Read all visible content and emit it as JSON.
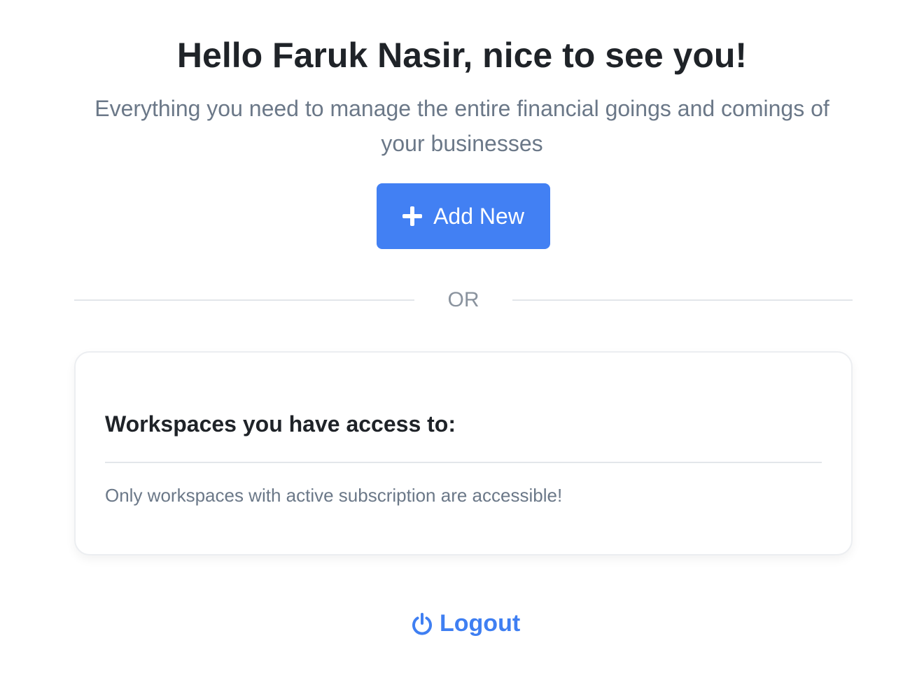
{
  "header": {
    "greeting": "Hello Faruk Nasir, nice to see you!",
    "subtitle": "Everything you need to manage the entire financial goings and comings of your businesses"
  },
  "actions": {
    "add_new_label": "Add New",
    "add_new_icon": "plus-icon",
    "or_label": "OR"
  },
  "workspaces": {
    "title": "Workspaces you have access to:",
    "note": "Only workspaces with active subscription are accessible!"
  },
  "footer": {
    "logout_label": "Logout",
    "logout_icon": "power-icon"
  },
  "colors": {
    "accent": "#4280f3",
    "link": "#3f7ff2",
    "heading": "#1f2328",
    "muted": "#6b7888"
  }
}
